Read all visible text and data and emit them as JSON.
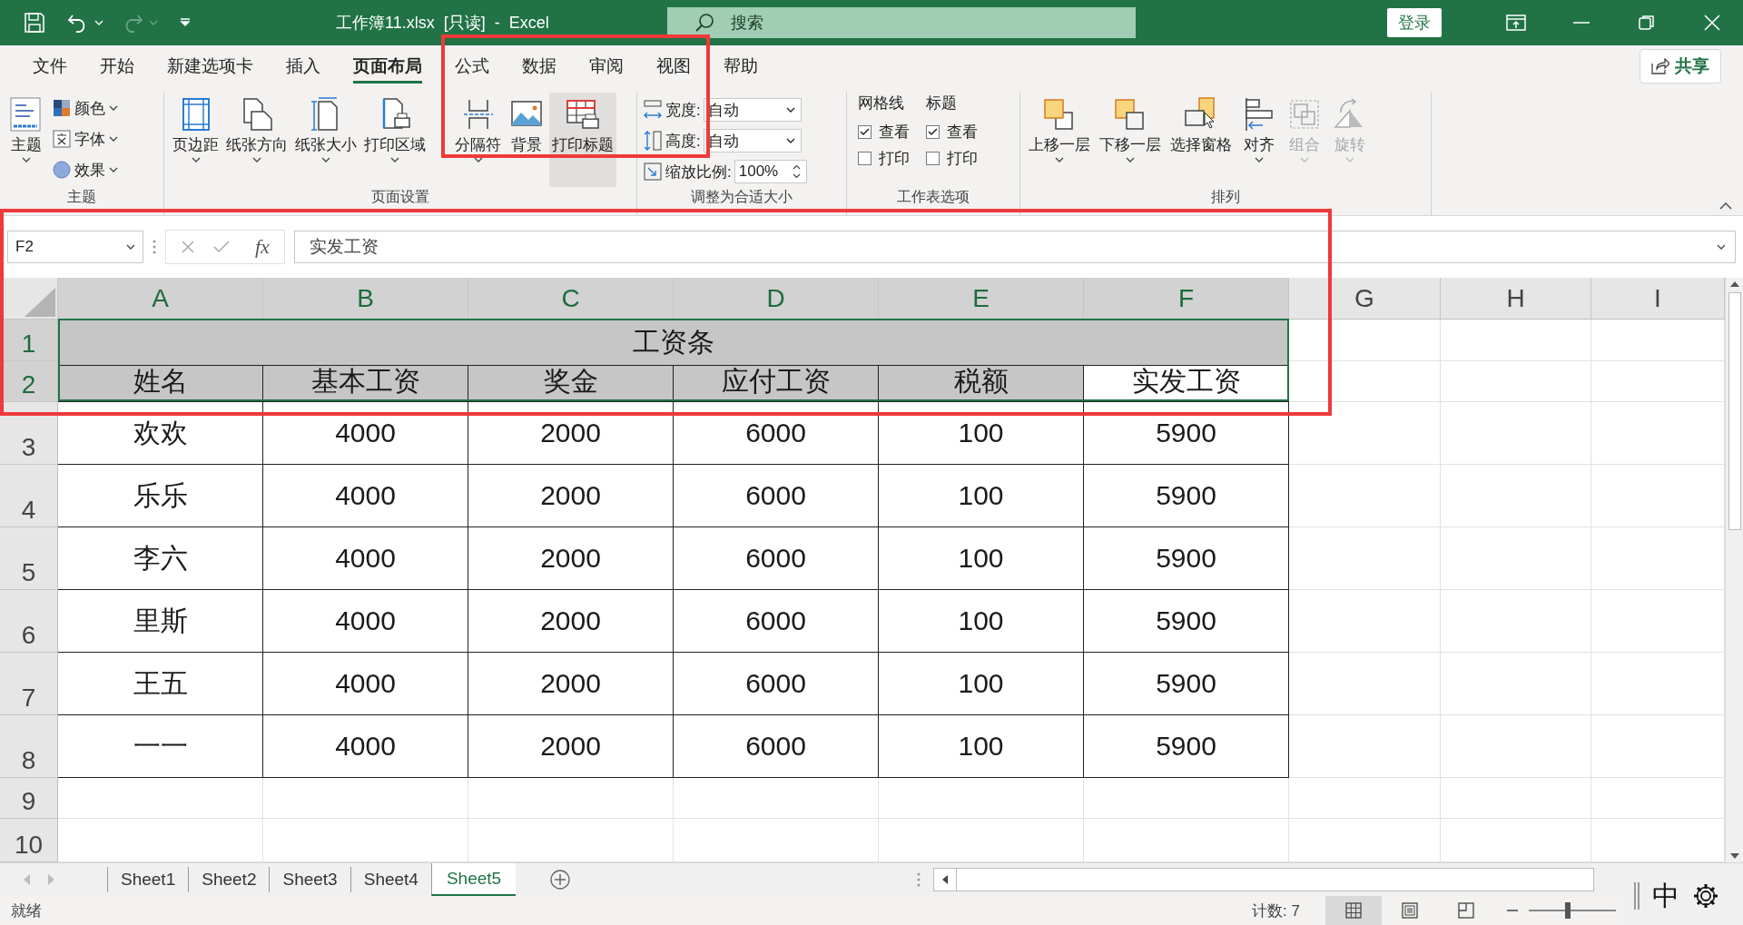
{
  "title_bar": {
    "title": "工作簿11.xlsx  [只读]  -  Excel",
    "search": {
      "placeholder": "搜索"
    },
    "login_button": "登录"
  },
  "menu_tabs": [
    {
      "label": "文件",
      "selected": false
    },
    {
      "label": "开始",
      "selected": false
    },
    {
      "label": "新建选项卡",
      "selected": false
    },
    {
      "label": "插入",
      "selected": false
    },
    {
      "label": "页面布局",
      "selected": true
    },
    {
      "label": "公式",
      "selected": false
    },
    {
      "label": "数据",
      "selected": false
    },
    {
      "label": "审阅",
      "selected": false
    },
    {
      "label": "视图",
      "selected": false
    },
    {
      "label": "帮助",
      "selected": false
    }
  ],
  "share_button": "共享",
  "ribbon": {
    "theme_group": {
      "label": "主题",
      "big_button": "主题",
      "items": [
        "颜色",
        "字体",
        "效果"
      ]
    },
    "page_setup_group": {
      "label": "页面设置",
      "buttons": [
        {
          "label": "页边距",
          "dropdown": true,
          "highlighted": false
        },
        {
          "label": "纸张方向",
          "dropdown": true,
          "highlighted": false
        },
        {
          "label": "纸张大小",
          "dropdown": true,
          "highlighted": false
        },
        {
          "label": "打印区域",
          "dropdown": true,
          "highlighted": false
        },
        {
          "label": "分隔符",
          "dropdown": true,
          "highlighted": false
        },
        {
          "label": "背景",
          "dropdown": false,
          "highlighted": false
        },
        {
          "label": "打印标题",
          "dropdown": false,
          "highlighted": true
        }
      ]
    },
    "scale_group": {
      "label": "调整为合适大小",
      "rows": [
        {
          "kind": "dropdown",
          "label": "宽度:",
          "value": "自动"
        },
        {
          "kind": "dropdown",
          "label": "高度:",
          "value": "自动"
        },
        {
          "kind": "spinner",
          "label": "缩放比例:",
          "value": "100%"
        }
      ]
    },
    "sheet_options_group": {
      "label": "工作表选项",
      "columns": [
        {
          "heading": "网格线",
          "options": [
            {
              "label": "查看",
              "checked": true
            },
            {
              "label": "打印",
              "checked": false
            }
          ]
        },
        {
          "heading": "标题",
          "options": [
            {
              "label": "查看",
              "checked": true
            },
            {
              "label": "打印",
              "checked": false
            }
          ]
        }
      ]
    },
    "arrange_group": {
      "label": "排列",
      "buttons": [
        {
          "label": "上移一层",
          "dropdown": true,
          "disabled": false
        },
        {
          "label": "下移一层",
          "dropdown": true,
          "disabled": false
        },
        {
          "label": "选择窗格",
          "dropdown": false,
          "disabled": false
        },
        {
          "label": "对齐",
          "dropdown": true,
          "disabled": false
        },
        {
          "label": "组合",
          "dropdown": true,
          "disabled": true
        },
        {
          "label": "旋转",
          "dropdown": true,
          "disabled": true
        }
      ]
    }
  },
  "formula_bar": {
    "name_box": "F2",
    "function_button": "fx",
    "value": "实发工资"
  },
  "sheet": {
    "columns": [
      {
        "label": "A",
        "highlighted": true
      },
      {
        "label": "B",
        "highlighted": true
      },
      {
        "label": "C",
        "highlighted": true
      },
      {
        "label": "D",
        "highlighted": true
      },
      {
        "label": "E",
        "highlighted": true
      },
      {
        "label": "F",
        "highlighted": true
      },
      {
        "label": "G",
        "highlighted": false
      },
      {
        "label": "H",
        "highlighted": false
      },
      {
        "label": "I",
        "highlighted": false
      }
    ],
    "title_row": {
      "row": "1",
      "highlighted": true,
      "text": "工资条"
    },
    "header_row": {
      "row": "2",
      "highlighted": true,
      "cells": [
        {
          "text": "姓名",
          "selected": false
        },
        {
          "text": "基本工资",
          "selected": false
        },
        {
          "text": "奖金",
          "selected": false
        },
        {
          "text": "应付工资",
          "selected": false
        },
        {
          "text": "税额",
          "selected": false
        },
        {
          "text": "实发工资",
          "selected": true
        }
      ]
    },
    "rows": [
      {
        "row": "3",
        "highlighted": false,
        "cells": [
          "欢欢",
          "4000",
          "2000",
          "6000",
          "100",
          "5900"
        ]
      },
      {
        "row": "4",
        "highlighted": false,
        "cells": [
          "乐乐",
          "4000",
          "2000",
          "6000",
          "100",
          "5900"
        ]
      },
      {
        "row": "5",
        "highlighted": false,
        "cells": [
          "李六",
          "4000",
          "2000",
          "6000",
          "100",
          "5900"
        ]
      },
      {
        "row": "6",
        "highlighted": false,
        "cells": [
          "里斯",
          "4000",
          "2000",
          "6000",
          "100",
          "5900"
        ]
      },
      {
        "row": "7",
        "highlighted": false,
        "cells": [
          "王五",
          "4000",
          "2000",
          "6000",
          "100",
          "5900"
        ]
      },
      {
        "row": "8",
        "highlighted": false,
        "cells": [
          "一一",
          "4000",
          "2000",
          "6000",
          "100",
          "5900"
        ]
      }
    ],
    "empty_rows": [
      {
        "row": "9",
        "highlighted": false
      },
      {
        "row": "10",
        "highlighted": false
      }
    ]
  },
  "sheet_tabs": [
    {
      "label": "Sheet1",
      "selected": false
    },
    {
      "label": "Sheet2",
      "selected": false
    },
    {
      "label": "Sheet3",
      "selected": false
    },
    {
      "label": "Sheet4",
      "selected": false
    },
    {
      "label": "Sheet5",
      "selected": true
    }
  ],
  "status_bar": {
    "status": "就绪",
    "count": "计数: 7",
    "views": [
      {
        "selected": true
      },
      {
        "selected": false
      },
      {
        "selected": false
      }
    ],
    "zoom_slider": {
      "level": 0.45
    }
  },
  "ime": {
    "mode": "中"
  }
}
